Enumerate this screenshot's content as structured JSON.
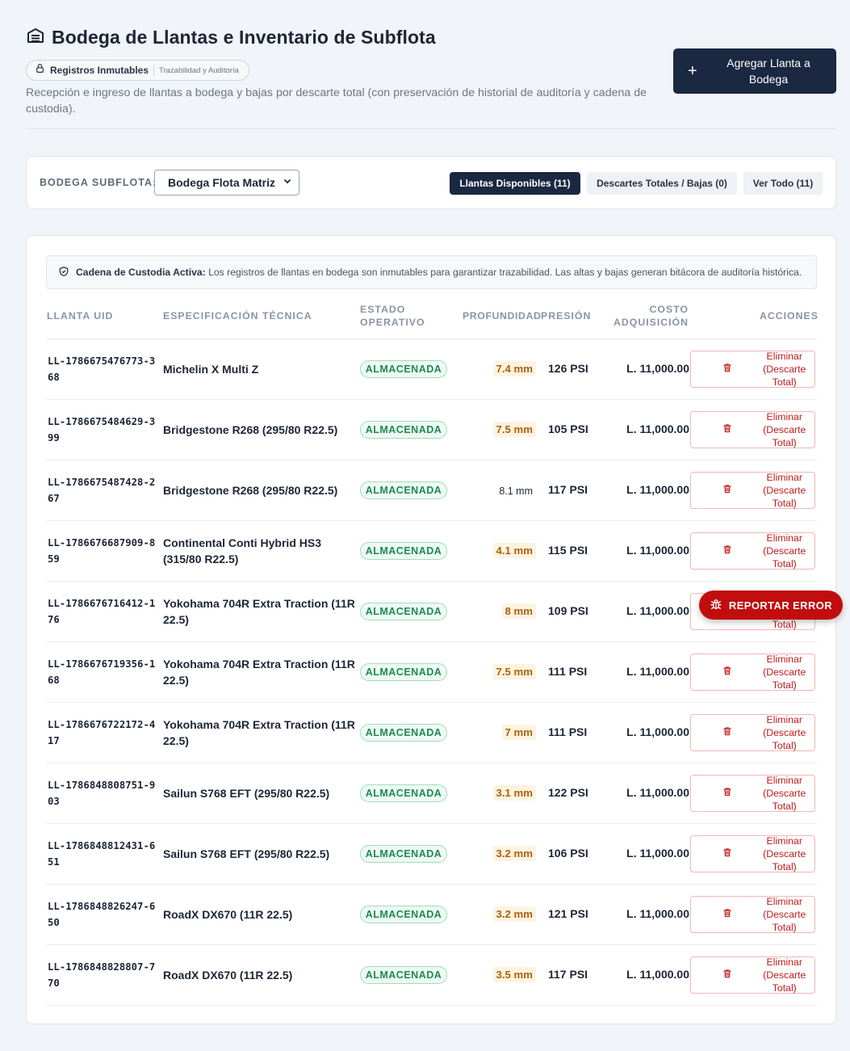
{
  "header": {
    "title": "Bodega de Llantas e Inventario de Subflota",
    "title_icon": "warehouse-icon",
    "pill_label": "Registros Inmutables",
    "pill_icon": "lock-icon",
    "pill_sub": "Trazabilidad y Auditoría",
    "subtitle": "Recepción e ingreso de llantas a bodega y bajas por descarte total (con preservación de historial de auditoría y cadena de custodia).",
    "add_button": "Agregar Llanta a Bodega"
  },
  "filters": {
    "label": "BODEGA SUBFLOTA:",
    "selected": "Bodega Flota Matriz",
    "tabs": [
      {
        "label": "Llantas Disponibles (11)",
        "active": true
      },
      {
        "label": "Descartes Totales / Bajas (0)",
        "active": false
      },
      {
        "label": "Ver Todo (11)",
        "active": false
      }
    ]
  },
  "notice": {
    "title": "Cadena de Custodia Activa:",
    "text": "Los registros de llantas en bodega son inmutables para garantizar trazabilidad. Las altas y bajas generan bitácora de auditoría histórica."
  },
  "table": {
    "headers": {
      "uid": "LLANTA UID",
      "spec": "ESPECIFICACIÓN TÉCNICA",
      "status": "ESTADO OPERATIVO",
      "depth": "PROFUNDIDAD",
      "pressure": "PRESIÓN",
      "cost": "COSTO ADQUISICIÓN",
      "actions": "ACCIONES"
    },
    "action_label": "Eliminar (Descarte Total)",
    "rows": [
      {
        "uid": "LL-1786675476773-368",
        "spec": "Michelin X Multi Z",
        "status": "ALMACENADA",
        "depth": "7.4 mm",
        "warn": true,
        "psi": "126 PSI",
        "cost": "L. 11,000.00"
      },
      {
        "uid": "LL-1786675484629-399",
        "spec": "Bridgestone R268 (295/80 R22.5)",
        "status": "ALMACENADA",
        "depth": "7.5 mm",
        "warn": true,
        "psi": "105 PSI",
        "cost": "L. 11,000.00"
      },
      {
        "uid": "LL-1786675487428-267",
        "spec": "Bridgestone R268 (295/80 R22.5)",
        "status": "ALMACENADA",
        "depth": "8.1 mm",
        "warn": false,
        "psi": "117 PSI",
        "cost": "L. 11,000.00"
      },
      {
        "uid": "LL-1786676687909-859",
        "spec": "Continental Conti Hybrid HS3 (315/80 R22.5)",
        "status": "ALMACENADA",
        "depth": "4.1 mm",
        "warn": true,
        "psi": "115 PSI",
        "cost": "L. 11,000.00"
      },
      {
        "uid": "LL-1786676716412-176",
        "spec": "Yokohama 704R Extra Traction (11R 22.5)",
        "status": "ALMACENADA",
        "depth": "8 mm",
        "warn": true,
        "psi": "109 PSI",
        "cost": "L. 11,000.00"
      },
      {
        "uid": "LL-1786676719356-168",
        "spec": "Yokohama 704R Extra Traction (11R 22.5)",
        "status": "ALMACENADA",
        "depth": "7.5 mm",
        "warn": true,
        "psi": "111 PSI",
        "cost": "L. 11,000.00"
      },
      {
        "uid": "LL-1786676722172-417",
        "spec": "Yokohama 704R Extra Traction (11R 22.5)",
        "status": "ALMACENADA",
        "depth": "7 mm",
        "warn": true,
        "psi": "111 PSI",
        "cost": "L. 11,000.00"
      },
      {
        "uid": "LL-1786848808751-903",
        "spec": "Sailun S768 EFT (295/80 R22.5)",
        "status": "ALMACENADA",
        "depth": "3.1 mm",
        "warn": true,
        "psi": "122 PSI",
        "cost": "L. 11,000.00"
      },
      {
        "uid": "LL-1786848812431-651",
        "spec": "Sailun S768 EFT (295/80 R22.5)",
        "status": "ALMACENADA",
        "depth": "3.2 mm",
        "warn": true,
        "psi": "106 PSI",
        "cost": "L. 11,000.00"
      },
      {
        "uid": "LL-1786848826247-650",
        "spec": "RoadX DX670 (11R 22.5)",
        "status": "ALMACENADA",
        "depth": "3.2 mm",
        "warn": true,
        "psi": "121 PSI",
        "cost": "L. 11,000.00"
      },
      {
        "uid": "LL-1786848828807-770",
        "spec": "RoadX DX670 (11R 22.5)",
        "status": "ALMACENADA",
        "depth": "3.5 mm",
        "warn": true,
        "psi": "117 PSI",
        "cost": "L. 11,000.00"
      }
    ]
  },
  "report_button": "REPORTAR ERROR",
  "colors": {
    "primary": "#1a2841",
    "danger": "#c10d0d",
    "success": "#1d8a55",
    "warning": "#b06010"
  }
}
